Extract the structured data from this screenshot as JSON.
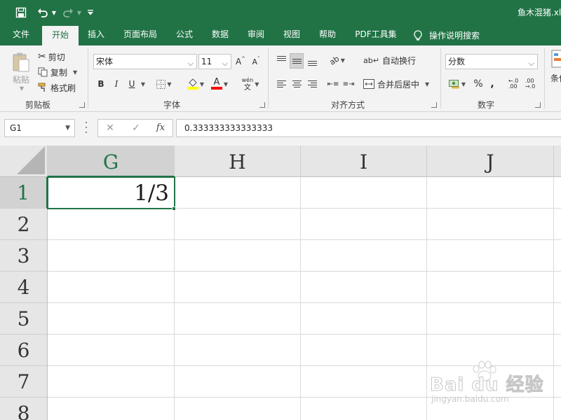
{
  "window": {
    "file_title": "鱼木混猪.xlsx"
  },
  "ribbon_tabs": [
    {
      "label": "文件",
      "active": false
    },
    {
      "label": "开始",
      "active": true
    },
    {
      "label": "插入",
      "active": false
    },
    {
      "label": "页面布局",
      "active": false
    },
    {
      "label": "公式",
      "active": false
    },
    {
      "label": "数据",
      "active": false
    },
    {
      "label": "审阅",
      "active": false
    },
    {
      "label": "视图",
      "active": false
    },
    {
      "label": "帮助",
      "active": false
    },
    {
      "label": "PDF工具集",
      "active": false
    }
  ],
  "tell_me": {
    "label": "操作说明搜索"
  },
  "clipboard": {
    "paste": "粘贴",
    "cut": "剪切",
    "copy": "复制",
    "format_painter": "格式刷",
    "group_label": "剪贴板"
  },
  "font": {
    "name": "宋体",
    "size": "11",
    "grow": "A",
    "shrink": "A",
    "bold": "B",
    "italic": "I",
    "underline": "U",
    "color_letter": "A",
    "phonetic_top": "wén",
    "phonetic_bottom": "文",
    "group_label": "字体",
    "highlight_color": "#ffff00",
    "font_color": "#ff0000"
  },
  "alignment": {
    "wrap_text": "自动换行",
    "merge_center": "合并后居中",
    "group_label": "对齐方式"
  },
  "number": {
    "format": "分数",
    "percent": "%",
    "comma": ",",
    "group_label": "数字"
  },
  "conditional": {
    "label_partial": "条件"
  },
  "formula_bar": {
    "name_box": "G1",
    "cancel": "✕",
    "enter": "✓",
    "fx": "fx",
    "content": "0.333333333333333"
  },
  "sheet": {
    "columns": [
      "G",
      "H",
      "I",
      "J"
    ],
    "selected_column": "G",
    "rows": [
      "1",
      "2",
      "3",
      "4",
      "5",
      "6",
      "7",
      "8"
    ],
    "selected_row": "1",
    "cells": {
      "G1": "1/3"
    }
  },
  "watermark": {
    "main": "Bai du 经验",
    "sub": "jingyan.baidu.com"
  },
  "colors": {
    "accent": "#217346",
    "ribbon_bg": "#f3f3f3",
    "header_bg": "#e6e6e6",
    "gridline": "#dadada"
  }
}
